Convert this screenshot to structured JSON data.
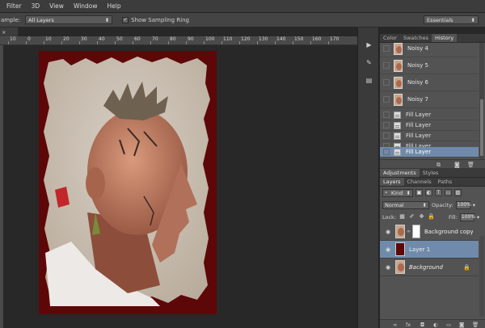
{
  "menu": [
    "Filter",
    "3D",
    "View",
    "Window",
    "Help"
  ],
  "options": {
    "sample_label": "ample:",
    "sample_value": "All Layers",
    "show_ring_label": "Show Sampling Ring",
    "show_ring_checked": "✓",
    "workspace": "Essentials"
  },
  "doc_tab": {
    "close": "×"
  },
  "ruler": [
    "10",
    "0",
    "10",
    "20",
    "30",
    "40",
    "50",
    "60",
    "70",
    "80",
    "90",
    "100",
    "110",
    "120",
    "130",
    "140",
    "150",
    "160",
    "170"
  ],
  "history": {
    "tabs": [
      "Color",
      "Swatches",
      "History"
    ],
    "items": [
      {
        "label": "Noisy 4",
        "kind": "thumb"
      },
      {
        "label": "Noisy 5",
        "kind": "thumb"
      },
      {
        "label": "Noisy 6",
        "kind": "thumb"
      },
      {
        "label": "Noisy 7",
        "kind": "thumb"
      },
      {
        "label": "Fill Layer",
        "kind": "fill"
      },
      {
        "label": "Fill Layer",
        "kind": "fill"
      },
      {
        "label": "Fill Layer",
        "kind": "fill"
      },
      {
        "label": "Fill Layer",
        "kind": "fill"
      },
      {
        "label": "Fill Layer",
        "kind": "fill",
        "selected": true
      }
    ]
  },
  "adjust_tabs": [
    "Adjustments",
    "Styles"
  ],
  "layers": {
    "tabs": [
      "Layers",
      "Channels",
      "Paths"
    ],
    "filter": "Kind",
    "blend": "Normal",
    "opacity_label": "Opacity:",
    "opacity": "100%",
    "lock_label": "Lock:",
    "fill_label": "Fill:",
    "fill": "100%",
    "items": [
      {
        "name": "Background copy",
        "kind": "photo-mask"
      },
      {
        "name": "Layer 1",
        "kind": "solid",
        "selected": true
      },
      {
        "name": "Background",
        "kind": "photo",
        "locked": true
      }
    ]
  },
  "colors": {
    "document_fill": "#5e0708",
    "selection": "#6f8aab"
  }
}
